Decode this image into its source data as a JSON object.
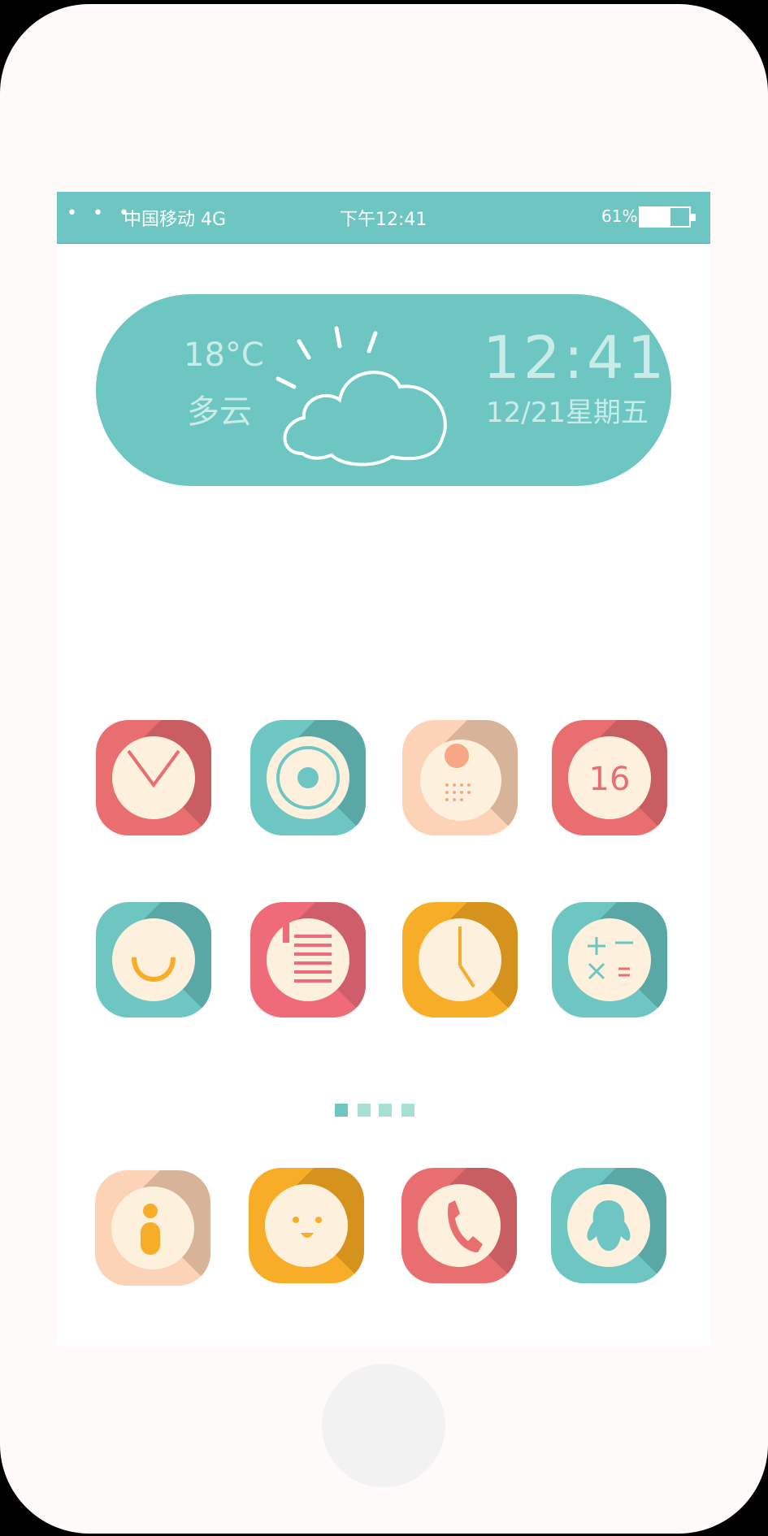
{
  "status_bar": {
    "signal_dots": "• • •",
    "carrier": "中国移动 4G",
    "time": "下午12:41",
    "battery_percent_label": "61%",
    "battery_level": 0.61
  },
  "weather_widget": {
    "temperature": "18°C",
    "condition": "多云",
    "time": "12:41",
    "date": "12/21星期五",
    "icon": "cloud-sun-icon"
  },
  "apps": [
    {
      "name": "app-mail",
      "icon": "envelope-icon",
      "color": "#e86e70"
    },
    {
      "name": "app-camera",
      "icon": "lens-icon",
      "color": "#6ec6c2"
    },
    {
      "name": "app-dots",
      "icon": "dots-icon",
      "color": "#fcd3b6"
    },
    {
      "name": "app-calendar",
      "icon": "calendar-icon",
      "color": "#e86e70",
      "label": "16"
    },
    {
      "name": "app-contacts",
      "icon": "smile-arc-icon",
      "color": "#6ec6c2"
    },
    {
      "name": "app-notes",
      "icon": "notes-icon",
      "color": "#ef6b7a"
    },
    {
      "name": "app-clock",
      "icon": "clock-icon",
      "color": "#f8ad28"
    },
    {
      "name": "app-calculator",
      "icon": "calculator-icon",
      "color": "#6ec6c2"
    },
    {
      "name": "app-info",
      "icon": "info-icon",
      "color": "#fcd3b6"
    },
    {
      "name": "app-face",
      "icon": "face-icon",
      "color": "#f8ad28"
    },
    {
      "name": "app-phone",
      "icon": "phone-icon",
      "color": "#e86e70"
    },
    {
      "name": "app-qq",
      "icon": "penguin-icon",
      "color": "#6ec6c2"
    }
  ],
  "pager": {
    "count": 4,
    "active_index": 0
  },
  "colors": {
    "teal": "#6ec6c2",
    "coral": "#e86e70",
    "peach": "#fcd3b6",
    "amber": "#f8ad28",
    "cream": "#fdf1de"
  }
}
